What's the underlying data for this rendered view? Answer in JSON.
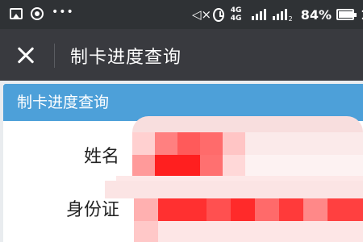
{
  "status_bar": {
    "net_type": "4G 4G",
    "sim_sub": "2",
    "battery_percent": "84%",
    "time": "1"
  },
  "title_bar": {
    "title": "制卡进度查询"
  },
  "card": {
    "header": "制卡进度查询",
    "fields": [
      {
        "label": "姓名"
      },
      {
        "label": "身份证"
      }
    ]
  },
  "colors": {
    "status_bar_bg": "#2f3235",
    "title_bar_bg": "#393a3f",
    "card_header_bg": "#4da0d9",
    "redaction_red": "#ff2a2a"
  }
}
